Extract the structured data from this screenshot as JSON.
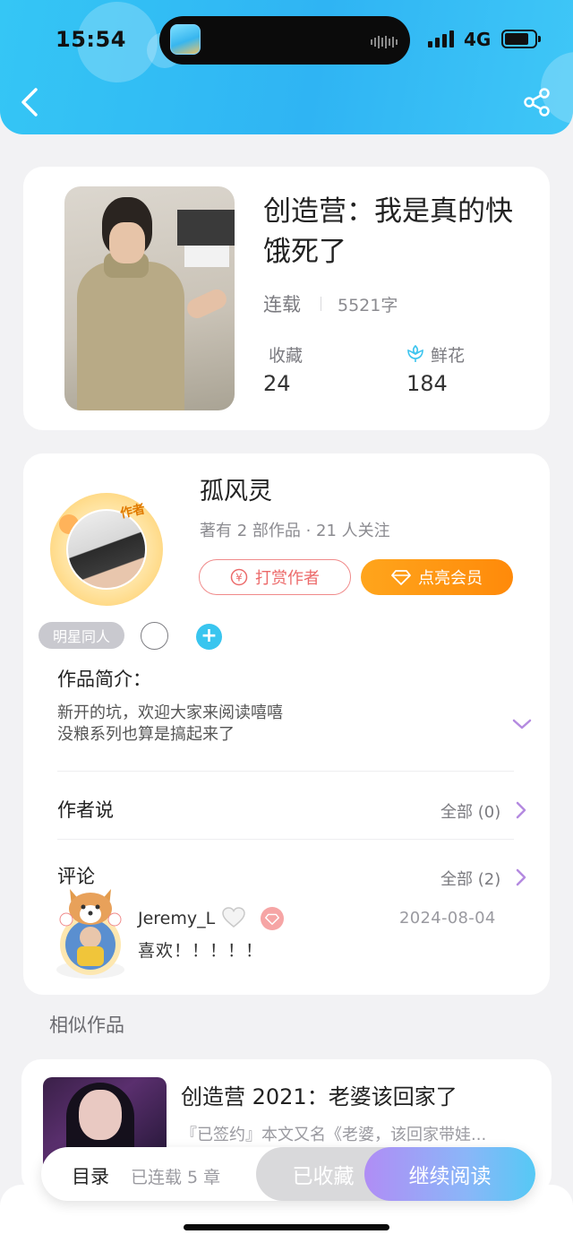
{
  "status_bar": {
    "time": "15:54",
    "network": "4G"
  },
  "header": {
    "back_icon": "chevron-left-icon",
    "share_icon": "share-icon"
  },
  "book": {
    "title": "创造营：我是真的快饿死了",
    "status": "连载",
    "word_count": "5521字",
    "favorites_label": "收藏",
    "favorites_count": "24",
    "flowers_label": "鲜花",
    "flowers_count": "184"
  },
  "author": {
    "name": "孤风灵",
    "avatar_tag": "作者",
    "meta": "著有 2 部作品 · 21 人关注",
    "tip_button": "打赏作者",
    "vip_button": "点亮会员",
    "tag": "明星同人",
    "add_tag": "+"
  },
  "intro": {
    "title": "作品简介：",
    "lines": [
      "新开的坑，欢迎大家来阅读嘻嘻",
      "没粮系列也算是搞起来了"
    ]
  },
  "author_says": {
    "title": "作者说",
    "all_label": "全部 (0)"
  },
  "comments": {
    "title": "评论",
    "all_label": "全部 (2)",
    "items": [
      {
        "user": "Jeremy_L",
        "date": "2024-08-04",
        "text": "喜欢！！！！！"
      }
    ]
  },
  "similar": {
    "title": "相似作品",
    "items": [
      {
        "title": "创造营 2021：老婆该回家了",
        "desc": "『已签约』本文又名《老婆，该回家带娃..."
      }
    ]
  },
  "bottom": {
    "toc_label": "目录",
    "toc_count": "已连载 5 章",
    "favorited": "已收藏",
    "continue_reading": "继续阅读"
  },
  "colors": {
    "accent": "#2fb4f3",
    "vip_orange": "#ff8a0a",
    "tip_red": "#ec6a6a",
    "chevron_purple": "#b48ae0"
  }
}
